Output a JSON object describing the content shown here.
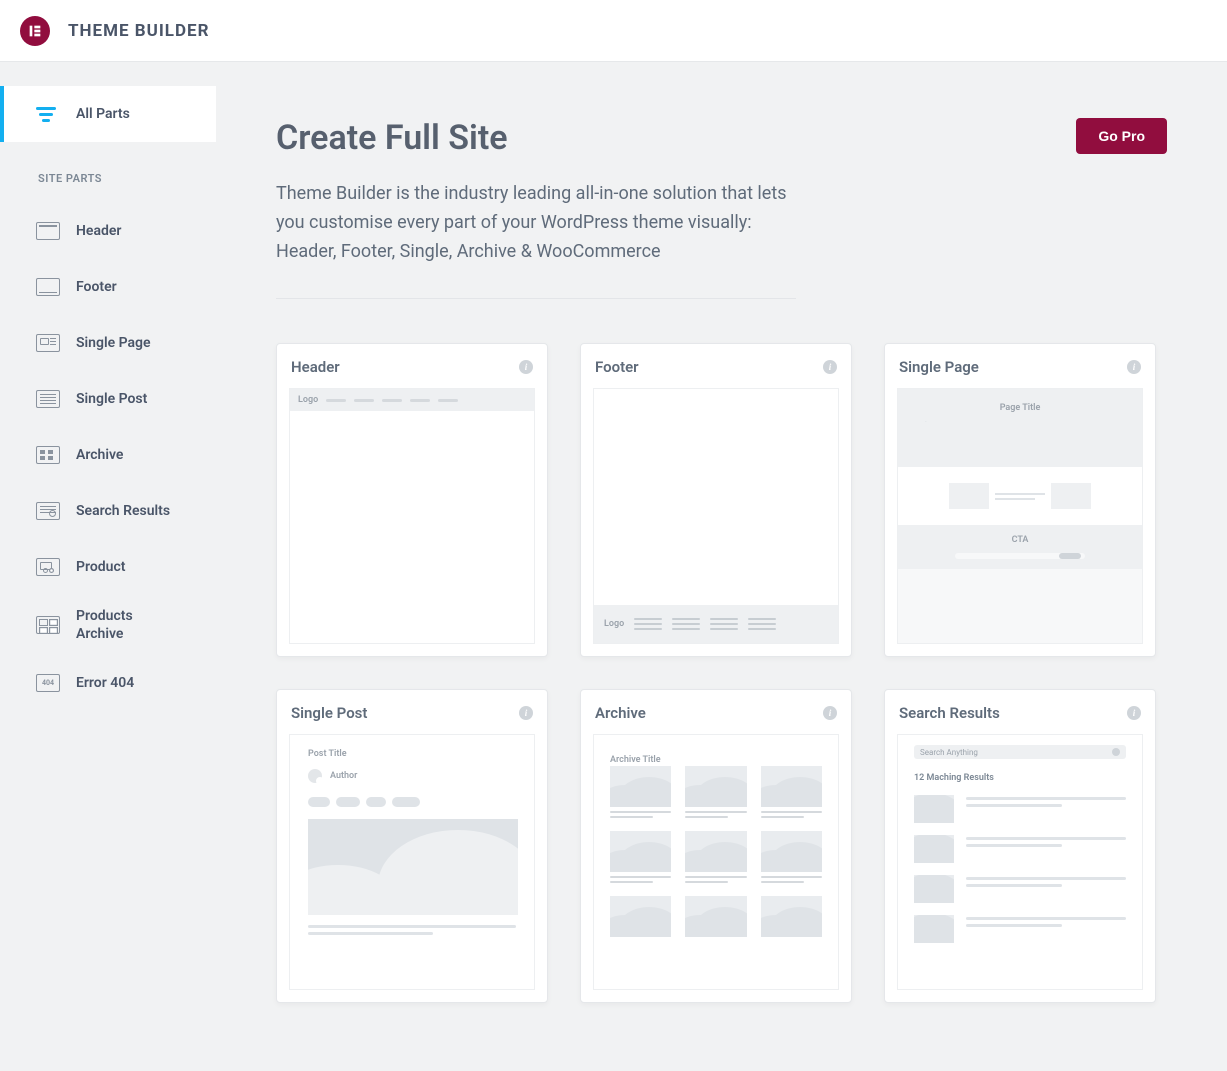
{
  "topbar": {
    "title": "THEME BUILDER"
  },
  "sidebar": {
    "all_parts": "All Parts",
    "section_label": "SITE PARTS",
    "items": [
      {
        "label": "Header"
      },
      {
        "label": "Footer"
      },
      {
        "label": "Single Page"
      },
      {
        "label": "Single Post"
      },
      {
        "label": "Archive"
      },
      {
        "label": "Search Results"
      },
      {
        "label": "Product"
      },
      {
        "label": "Products Archive"
      },
      {
        "label": "Error 404"
      }
    ]
  },
  "main": {
    "heading": "Create Full Site",
    "go_pro_label": "Go Pro",
    "intro": "Theme Builder is the industry leading all-in-one solution that lets you customise every part of your WordPress theme visually: Header, Footer, Single, Archive & WooCommerce"
  },
  "cards": {
    "header": {
      "title": "Header",
      "logo_text": "Logo"
    },
    "footer": {
      "title": "Footer",
      "logo_text": "Logo"
    },
    "single_page": {
      "title": "Single Page",
      "page_title": "Page Title",
      "cta": "CTA"
    },
    "single_post": {
      "title": "Single Post",
      "post_title": "Post Title",
      "author": "Author"
    },
    "archive": {
      "title": "Archive",
      "archive_title": "Archive Title"
    },
    "search": {
      "title": "Search Results",
      "placeholder": "Search Anything",
      "results_label": "12 Maching Results"
    }
  },
  "e404_text": "404"
}
